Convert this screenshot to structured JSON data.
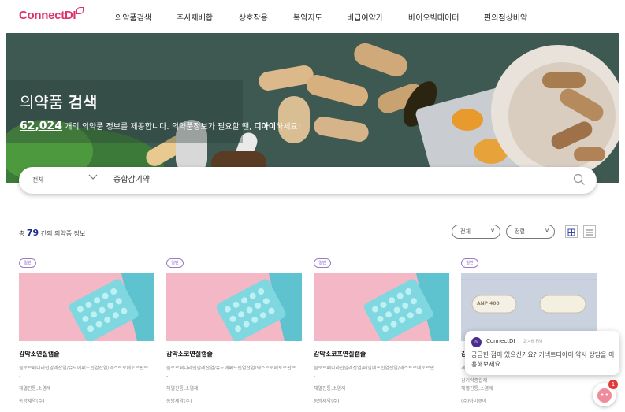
{
  "brand": {
    "logo_text": "ConnectDI"
  },
  "nav": {
    "items": [
      "의약품검색",
      "주사제배합",
      "상호작용",
      "복약지도",
      "비급여약가",
      "바이오빅데이터",
      "편의점상비약"
    ]
  },
  "hero": {
    "title_regular": "의약품 ",
    "title_bold": "검색",
    "count": "62,024",
    "sub_text": " 개의 의약품 정보를 제공합니다. 의약품정보가 필요할 땐, ",
    "sub_brand": "디아이",
    "sub_end": "하세요!"
  },
  "search": {
    "category": "전체",
    "query": "종합감기약"
  },
  "results": {
    "prefix": "총 ",
    "count": "79",
    "suffix": " 건의 의약품 정보",
    "filter_type": "전체",
    "filter_sort": "정렬"
  },
  "cards": [
    {
      "badge": "일반",
      "name": "감막소연질캡슐",
      "desc": "클로르페니라민말레산염/슈도에페드린염산염/덱스트로메토르판브롬화수소산염",
      "dash": "-",
      "meta1": "해열진통,소염제",
      "meta2": "동방제약(주)"
    },
    {
      "badge": "일반",
      "name": "감막소코연질캡슐",
      "desc": "클로르페니라민말레산염/슈도에페드린염산염/덱스트로메토르판브롬화수소산염",
      "dash": "-",
      "meta1": "해열진통,소염제",
      "meta2": "동방제약(주)"
    },
    {
      "badge": "일반",
      "name": "감막소코프연질캡슐",
      "desc": "클로르페니라민말레산염/페닐에프린염산염/덱스트로메토르판",
      "dash": "-",
      "meta1": "해열진통,소염제",
      "meta2": "동방제약(주)"
    },
    {
      "badge": "일반",
      "name": "감",
      "desc": "게",
      "dash": "",
      "meta1": "감기약종합제",
      "meta2": "해열진통,소염제",
      "meta3": "(주)아이큐어",
      "pill_text": "ANP 400"
    }
  ],
  "chat": {
    "avatar": "DI",
    "name": "ConnectDI",
    "time": "2:46 PM",
    "message": "궁금한 점이 있으신가요? 커넥트디아이 약사 상담을 이용해보세요.",
    "badge": "1"
  },
  "colors": {
    "brand": "#e0306b",
    "count_blue": "#1b2e8a",
    "badge_purple": "#7a55b0",
    "hero_bg": "#3f5a52",
    "thumb_pink": "#f3b7c6",
    "thumb_teal": "#5ec2cf"
  }
}
